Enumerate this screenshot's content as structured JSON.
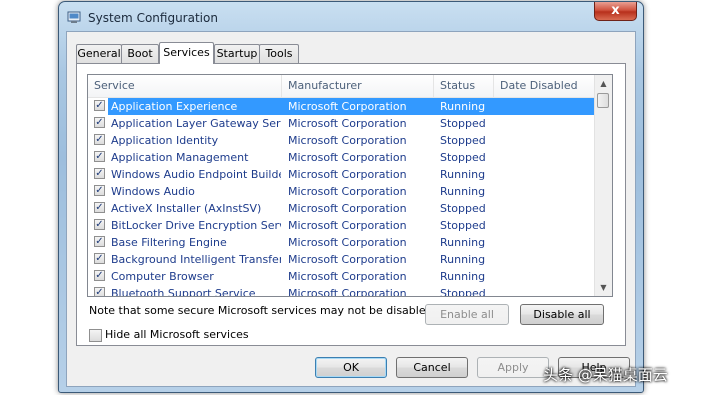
{
  "window": {
    "title": "System Configuration",
    "close": "x",
    "icon": "msconfig-icon"
  },
  "tabs": [
    {
      "label": "General"
    },
    {
      "label": "Boot"
    },
    {
      "label": "Services"
    },
    {
      "label": "Startup"
    },
    {
      "label": "Tools"
    }
  ],
  "active_tab": "Services",
  "columns": {
    "service": "Service",
    "manufacturer": "Manufacturer",
    "status": "Status",
    "date_disabled": "Date Disabled"
  },
  "services": [
    {
      "checked": true,
      "name": "Application Experience",
      "manufacturer": "Microsoft Corporation",
      "status": "Running",
      "selected": true
    },
    {
      "checked": true,
      "name": "Application Layer Gateway Service",
      "manufacturer": "Microsoft Corporation",
      "status": "Stopped"
    },
    {
      "checked": true,
      "name": "Application Identity",
      "manufacturer": "Microsoft Corporation",
      "status": "Stopped"
    },
    {
      "checked": true,
      "name": "Application Management",
      "manufacturer": "Microsoft Corporation",
      "status": "Stopped"
    },
    {
      "checked": true,
      "name": "Windows Audio Endpoint Builder",
      "manufacturer": "Microsoft Corporation",
      "status": "Running"
    },
    {
      "checked": true,
      "name": "Windows Audio",
      "manufacturer": "Microsoft Corporation",
      "status": "Running"
    },
    {
      "checked": true,
      "name": "ActiveX Installer (AxInstSV)",
      "manufacturer": "Microsoft Corporation",
      "status": "Stopped"
    },
    {
      "checked": true,
      "name": "BitLocker Drive Encryption Service",
      "manufacturer": "Microsoft Corporation",
      "status": "Stopped"
    },
    {
      "checked": true,
      "name": "Base Filtering Engine",
      "manufacturer": "Microsoft Corporation",
      "status": "Running"
    },
    {
      "checked": true,
      "name": "Background Intelligent Transfer ...",
      "manufacturer": "Microsoft Corporation",
      "status": "Running"
    },
    {
      "checked": true,
      "name": "Computer Browser",
      "manufacturer": "Microsoft Corporation",
      "status": "Running"
    },
    {
      "checked": true,
      "name": "Bluetooth Support Service",
      "manufacturer": "Microsoft Corporation",
      "status": "Stopped"
    }
  ],
  "note": "Note that some secure Microsoft services may not be disabled.",
  "enable_all": "Enable all",
  "disable_all": "Disable all",
  "hide_ms_services": {
    "label": "Hide all Microsoft services",
    "checked": false
  },
  "buttons": {
    "ok": "OK",
    "cancel": "Cancel",
    "apply": "Apply",
    "help": "Help"
  },
  "watermark": "头条 @呆猫桌面云",
  "colors": {
    "selection": "#3399ff",
    "close_button": "#c8412b",
    "link_text": "#1e3c8c"
  }
}
